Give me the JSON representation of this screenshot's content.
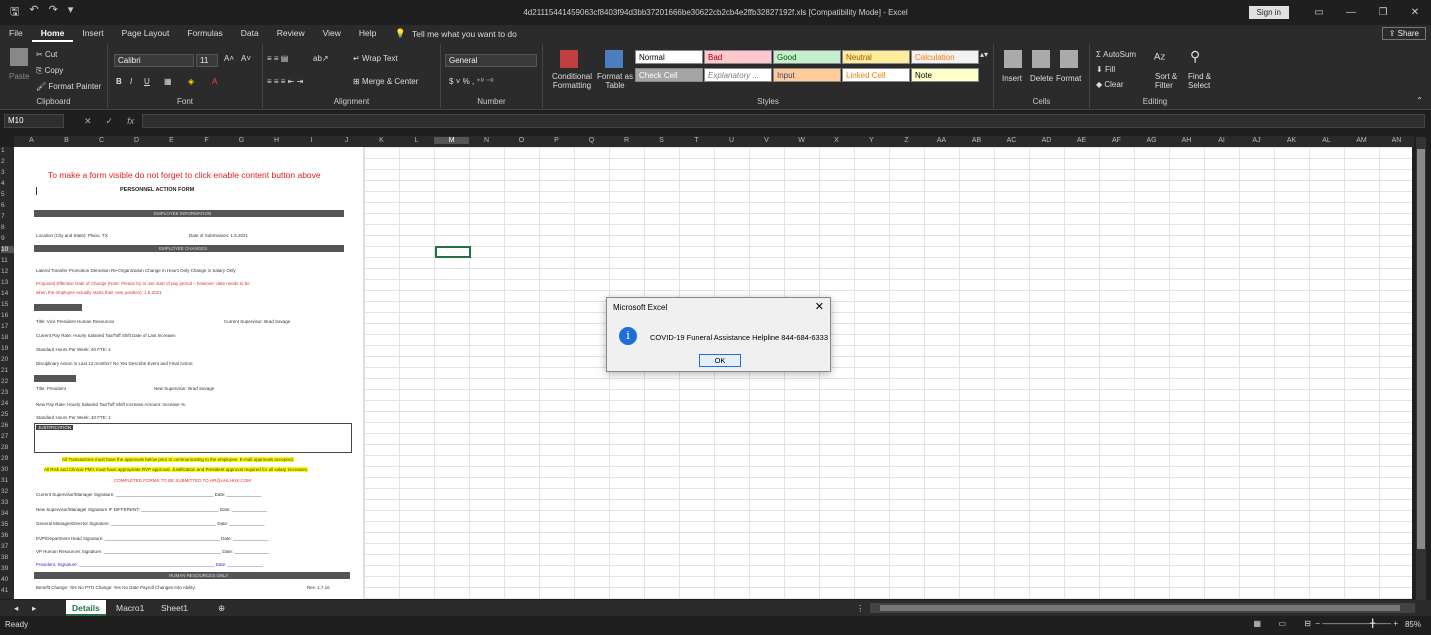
{
  "window": {
    "title": "4d21115441459063cf8403f94d3bb37201666be30622cb2cb4e2ffb32827192f.xls [Compatibility Mode] - Excel",
    "sign_in": "Sign in"
  },
  "tabs": [
    "File",
    "Home",
    "Insert",
    "Page Layout",
    "Formulas",
    "Data",
    "Review",
    "View",
    "Help"
  ],
  "active_tab": "Home",
  "tell_me": "Tell me what you want to do",
  "share": "Share",
  "ribbon": {
    "clipboard": {
      "name": "Clipboard",
      "paste": "Paste",
      "cut": "Cut",
      "copy": "Copy",
      "format_painter": "Format Painter"
    },
    "font": {
      "name": "Font",
      "family": "Calibri",
      "size": "11"
    },
    "alignment": {
      "name": "Alignment",
      "wrap": "Wrap Text",
      "merge": "Merge & Center"
    },
    "number": {
      "name": "Number",
      "format": "General"
    },
    "styles": {
      "name": "Styles",
      "conditional": "Conditional Formatting",
      "format_as_table": "Format as Table",
      "cells": [
        {
          "label": "Normal",
          "bg": "#ffffff",
          "fg": "#000000"
        },
        {
          "label": "Bad",
          "bg": "#ffc7ce",
          "fg": "#9c0006"
        },
        {
          "label": "Good",
          "bg": "#c6efce",
          "fg": "#006100"
        },
        {
          "label": "Neutral",
          "bg": "#ffeb9c",
          "fg": "#9c5700"
        },
        {
          "label": "Calculation",
          "bg": "#f2f2f2",
          "fg": "#fa7d00"
        },
        {
          "label": "Check Cell",
          "bg": "#a5a5a5",
          "fg": "#ffffff"
        },
        {
          "label": "Explanatory ...",
          "bg": "#ffffff",
          "fg": "#7f7f7f"
        },
        {
          "label": "Input",
          "bg": "#ffcc99",
          "fg": "#3f3f76"
        },
        {
          "label": "Linked Cell",
          "bg": "#ffffff",
          "fg": "#fa7d00"
        },
        {
          "label": "Note",
          "bg": "#ffffcc",
          "fg": "#000000"
        }
      ]
    },
    "cells": {
      "name": "Cells",
      "insert": "Insert",
      "delete": "Delete",
      "format": "Format"
    },
    "editing": {
      "name": "Editing",
      "autosum": "AutoSum",
      "fill": "Fill",
      "clear": "Clear",
      "sort": "Sort & Filter",
      "find": "Find & Select"
    }
  },
  "name_box": "M10",
  "columns": [
    "A",
    "B",
    "C",
    "D",
    "E",
    "F",
    "G",
    "H",
    "I",
    "J",
    "K",
    "L",
    "M",
    "N",
    "O",
    "P",
    "Q",
    "R",
    "S",
    "T",
    "U",
    "V",
    "W",
    "X",
    "Y",
    "Z",
    "AA",
    "AB",
    "AC",
    "AD",
    "AE",
    "AF",
    "AG",
    "AH",
    "AI",
    "AJ",
    "AK",
    "AL",
    "AM",
    "AN"
  ],
  "rows": [
    "1",
    "2",
    "3",
    "4",
    "5",
    "6",
    "7",
    "8",
    "9",
    "10",
    "11",
    "12",
    "13",
    "14",
    "15",
    "16",
    "17",
    "18",
    "19",
    "20",
    "21",
    "22",
    "23",
    "24",
    "25",
    "26",
    "27",
    "28",
    "29",
    "30",
    "31",
    "32",
    "33",
    "34",
    "35",
    "36",
    "37",
    "38",
    "39",
    "40",
    "41"
  ],
  "warning_text": "To make a form visible do not forget to click enable content button above",
  "form": {
    "title": "PERSONNEL ACTION FORM",
    "section1": "EMPLOYEE INFORMATION",
    "location": "Location (City and State):   Plano, TX",
    "submission": "Date of Submission: 1.5.2021",
    "section2": "EMPLOYEE CHANGES",
    "changes": "Lateral Transfer   Promotion   Demotion   Re-Organization   Change in Hours Only   Change in Salary Only",
    "proposed": "Proposed Effective Date of Change (Note: Please try to use start of pay period – however, date needs to be",
    "proposed2": "when the employee actually starts their new position): 1.5.2021",
    "title_line": "Title: Vice President Human Resources",
    "supervisor": "Current Supervisor: Brad Savage",
    "pay": "Current Pay Rate:        Hourly    Salaried    Tax/Toff Shift    Date of Last Increase:",
    "hours": "Standard Hours Per Week: 40   FTE: 1",
    "disciplinary": "Disciplinary Action in Last 12 months?   No   Yes   Describe Event and Final Action:",
    "new_title": "Title: President",
    "new_supervisor": "New Supervisor: Brad Savage",
    "new_pay": "New Pay Rate:        Hourly    Salaried    Tax/Toff Shift    Increase Amount:        Increase %:",
    "new_hours": "Standard Hours Per Week: 40   FTE: 1",
    "justification": "JUSTIFICATION",
    "note1": "All Transactions must have the approvals below prior to communicating to the employee. E-mail approvals accepted.",
    "note2": "All Risk and Clinical PM's must have appropriate RVP approval.          Justification and President approval required for all salary increases.",
    "note3": "COMPLETED FORMS TO BE SUBMITTED TO HR@AHLHHS.COM",
    "sig1": "Current Supervisor/Manager Signature: _______________________________________  Date: ______________",
    "sig2": "New Supervisor/Manager Signature IF DIFFERENT: _______________________________  Date: ______________",
    "sig3": "General Manager/Director Signature: __________________________________________  Date: ______________",
    "sig4": "EVP/Department Head Signature: ______________________________________________  Date: ______________",
    "sig5": "VP Human Resources Signature: _______________________________________________  Date: ______________",
    "sig6": "President, Signature: ______________________________________________________  Date: ______________",
    "section3": "HUMAN RESOURCES ONLY",
    "footer": "Benefit Change: Yes   No   PTO Change: Yes   No   Date Payroll Changes Into Ability:",
    "rev": "Rev. 1.7.16"
  },
  "sheet_tabs": [
    "Details",
    "Macro1",
    "Sheet1"
  ],
  "active_sheet": "Details",
  "status": "Ready",
  "zoom": "85%",
  "dialog": {
    "title": "Microsoft Excel",
    "message": "COVID-19 Funeral Assistance Helpline 844-684-6333",
    "ok": "OK"
  }
}
